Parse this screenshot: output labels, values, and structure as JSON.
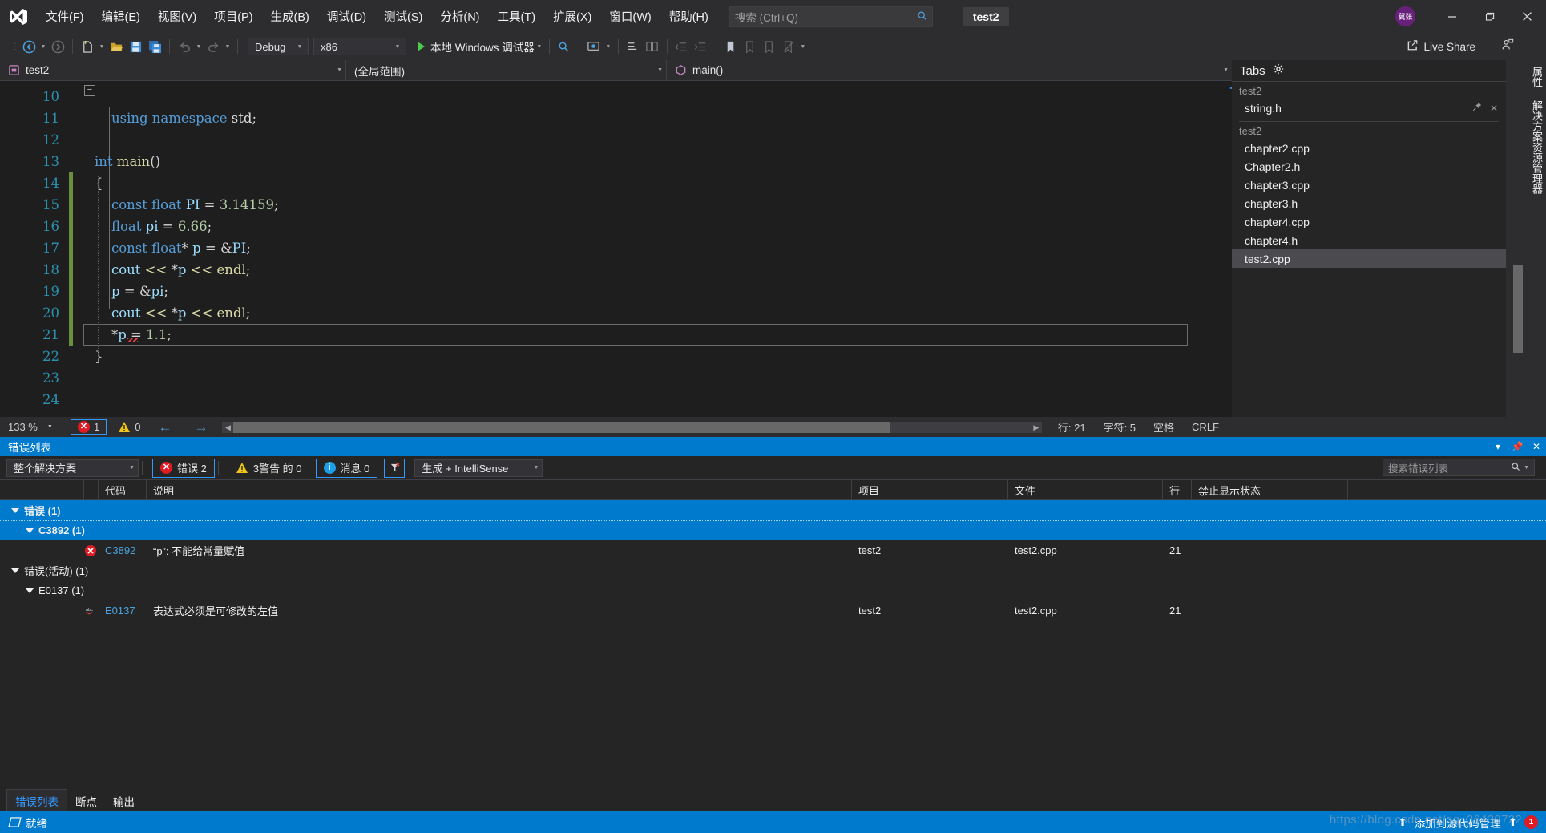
{
  "titlebar": {
    "logo_icon": "visual-studio-logo",
    "menus": [
      "文件(F)",
      "编辑(E)",
      "视图(V)",
      "项目(P)",
      "生成(B)",
      "调试(D)",
      "测试(S)",
      "分析(N)",
      "工具(T)",
      "扩展(X)",
      "窗口(W)",
      "帮助(H)"
    ],
    "search_placeholder": "搜索 (Ctrl+Q)",
    "search_icon": "search-icon",
    "project_chip": "test2",
    "avatar_text": "冀张",
    "minimize_icon": "minimize-icon",
    "restore_icon": "restore-icon",
    "close_icon": "close-icon"
  },
  "toolbar": {
    "nav_back_icon": "navigate-back-icon",
    "nav_forward_icon": "navigate-forward-icon",
    "new_item_icon": "new-item-icon",
    "open_icon": "open-folder-icon",
    "save_icon": "save-icon",
    "save_all_icon": "save-all-icon",
    "undo_icon": "undo-icon",
    "redo_icon": "redo-icon",
    "config": "Debug",
    "platform": "x86",
    "run_label": "本地 Windows 调试器",
    "run_icon": "play-icon",
    "live_share_label": "Live Share",
    "live_share_icon": "live-share-icon",
    "feedback_icon": "feedback-icon"
  },
  "editor_nav": {
    "project": "test2",
    "scope": "(全局范围)",
    "member": "main()",
    "project_icon": "project-icon",
    "member_icon": "method-icon"
  },
  "code": {
    "lines": [
      {
        "num": "10",
        "changed": false,
        "tokens": []
      },
      {
        "num": "11",
        "changed": false,
        "tokens": [
          {
            "t": "    ",
            "c": "op"
          },
          {
            "t": "using",
            "c": "k"
          },
          {
            "t": " ",
            "c": "op"
          },
          {
            "t": "namespace",
            "c": "k"
          },
          {
            "t": " ",
            "c": "op"
          },
          {
            "t": "std",
            "c": "id"
          },
          {
            "t": ";",
            "c": "op"
          }
        ]
      },
      {
        "num": "12",
        "changed": false,
        "tokens": []
      },
      {
        "num": "13",
        "changed": false,
        "tokens": [
          {
            "t": "int",
            "c": "k"
          },
          {
            "t": " ",
            "c": "op"
          },
          {
            "t": "main",
            "c": "fn"
          },
          {
            "t": "()",
            "c": "op"
          }
        ]
      },
      {
        "num": "14",
        "changed": true,
        "tokens": [
          {
            "t": "{",
            "c": "op"
          }
        ]
      },
      {
        "num": "15",
        "changed": true,
        "tokens": [
          {
            "t": "    ",
            "c": "op"
          },
          {
            "t": "const",
            "c": "k"
          },
          {
            "t": " ",
            "c": "op"
          },
          {
            "t": "float",
            "c": "k"
          },
          {
            "t": " ",
            "c": "op"
          },
          {
            "t": "PI",
            "c": "var"
          },
          {
            "t": " = ",
            "c": "op"
          },
          {
            "t": "3.14159",
            "c": "n"
          },
          {
            "t": ";",
            "c": "op"
          }
        ]
      },
      {
        "num": "16",
        "changed": true,
        "tokens": [
          {
            "t": "    ",
            "c": "op"
          },
          {
            "t": "float",
            "c": "k"
          },
          {
            "t": " ",
            "c": "op"
          },
          {
            "t": "pi",
            "c": "var"
          },
          {
            "t": " = ",
            "c": "op"
          },
          {
            "t": "6.66",
            "c": "n"
          },
          {
            "t": ";",
            "c": "op"
          }
        ]
      },
      {
        "num": "17",
        "changed": true,
        "tokens": [
          {
            "t": "    ",
            "c": "op"
          },
          {
            "t": "const",
            "c": "k"
          },
          {
            "t": " ",
            "c": "op"
          },
          {
            "t": "float",
            "c": "k"
          },
          {
            "t": "* ",
            "c": "op"
          },
          {
            "t": "p",
            "c": "var"
          },
          {
            "t": " = ",
            "c": "op"
          },
          {
            "t": "&",
            "c": "op"
          },
          {
            "t": "PI",
            "c": "var"
          },
          {
            "t": ";",
            "c": "op"
          }
        ]
      },
      {
        "num": "18",
        "changed": true,
        "tokens": [
          {
            "t": "    ",
            "c": "op"
          },
          {
            "t": "cout",
            "c": "var"
          },
          {
            "t": " ",
            "c": "op"
          },
          {
            "t": "<<",
            "c": "fn"
          },
          {
            "t": " *",
            "c": "op"
          },
          {
            "t": "p",
            "c": "var"
          },
          {
            "t": " ",
            "c": "op"
          },
          {
            "t": "<<",
            "c": "fn"
          },
          {
            "t": " ",
            "c": "op"
          },
          {
            "t": "endl",
            "c": "fn"
          },
          {
            "t": ";",
            "c": "op"
          }
        ]
      },
      {
        "num": "19",
        "changed": true,
        "tokens": [
          {
            "t": "    ",
            "c": "op"
          },
          {
            "t": "p",
            "c": "var"
          },
          {
            "t": " = ",
            "c": "op"
          },
          {
            "t": "&",
            "c": "op"
          },
          {
            "t": "pi",
            "c": "var"
          },
          {
            "t": ";",
            "c": "op"
          }
        ]
      },
      {
        "num": "20",
        "changed": true,
        "tokens": [
          {
            "t": "    ",
            "c": "op"
          },
          {
            "t": "cout",
            "c": "var"
          },
          {
            "t": " ",
            "c": "op"
          },
          {
            "t": "<<",
            "c": "fn"
          },
          {
            "t": " *",
            "c": "op"
          },
          {
            "t": "p",
            "c": "var"
          },
          {
            "t": " ",
            "c": "op"
          },
          {
            "t": "<<",
            "c": "fn"
          },
          {
            "t": " ",
            "c": "op"
          },
          {
            "t": "endl",
            "c": "fn"
          },
          {
            "t": ";",
            "c": "op"
          }
        ]
      },
      {
        "num": "21",
        "changed": true,
        "current": true,
        "tokens": [
          {
            "t": "    *",
            "c": "op"
          },
          {
            "t": "p",
            "c": "var"
          },
          {
            "t": " = ",
            "c": "op"
          },
          {
            "t": "1.1",
            "c": "n"
          },
          {
            "t": ";",
            "c": "op"
          }
        ]
      },
      {
        "num": "22",
        "changed": false,
        "tokens": [
          {
            "t": "}",
            "c": "op"
          }
        ]
      },
      {
        "num": "23",
        "changed": false,
        "tokens": []
      },
      {
        "num": "24",
        "changed": false,
        "tokens": []
      }
    ]
  },
  "editor_status": {
    "zoom": "133 %",
    "error_count": "1",
    "warning_count": "0",
    "prev_icon": "arrow-left-icon",
    "next_icon": "arrow-right-icon",
    "line_label": "行: 21",
    "col_label": "字符: 5",
    "indent_label": "空格",
    "eol_label": "CRLF"
  },
  "error_panel": {
    "title": "错误列表",
    "float_icon": "float-window-icon",
    "pin_icon": "pin-icon",
    "close_icon": "close-icon",
    "scope": "整个解决方案",
    "errors_label": "错误 2",
    "warnings_label": "3警告 的 0",
    "messages_label": "消息 0",
    "build_filter": "生成 + IntelliSense",
    "filter_icon": "clear-filter-icon",
    "search_placeholder": "搜索错误列表",
    "search_icon": "search-icon",
    "columns": [
      "",
      "代码",
      "说明",
      "项目",
      "文件",
      "行",
      "禁止显示状态"
    ],
    "rows": [
      {
        "kind": "group",
        "level": 1,
        "label": "错误 (1)",
        "selected": true
      },
      {
        "kind": "group",
        "level": 2,
        "label": "C3892 (1)",
        "selected": true
      },
      {
        "kind": "error",
        "level": 3,
        "icon": "error-circle-icon",
        "code": "C3892",
        "desc": "“p”: 不能给常量赋值",
        "project": "test2",
        "file": "test2.cpp",
        "line": "21",
        "suppress": ""
      },
      {
        "kind": "group",
        "level": 1,
        "label": "错误(活动) (1)",
        "selected": false
      },
      {
        "kind": "group",
        "level": 2,
        "label": "E0137 (1)",
        "selected": false
      },
      {
        "kind": "error",
        "level": 3,
        "icon": "intellisense-squiggle-icon",
        "code": "E0137",
        "desc": "表达式必须是可修改的左值",
        "project": "test2",
        "file": "test2.cpp",
        "line": "21",
        "suppress": ""
      }
    ]
  },
  "bottom_tabs": {
    "items": [
      "错误列表",
      "断点",
      "输出"
    ],
    "active_index": 0
  },
  "statusbar": {
    "ready_label": "就绪",
    "ready_icon": "ready-icon",
    "add_source_control": "添加到源代码管理",
    "up_icon": "chevron-up-icon",
    "badge": "1",
    "watermark": "https://blog.csdn.net/qq_36439722"
  },
  "tabs_panel": {
    "title": "Tabs",
    "gear_icon": "gear-icon",
    "groups": [
      {
        "header": "test2",
        "items": [
          {
            "label": "string.h",
            "selected": false,
            "has_actions": true
          }
        ]
      },
      {
        "header": "test2",
        "items": [
          {
            "label": "chapter2.cpp",
            "selected": false
          },
          {
            "label": "Chapter2.h",
            "selected": false
          },
          {
            "label": "chapter3.cpp",
            "selected": false
          },
          {
            "label": "chapter3.h",
            "selected": false
          },
          {
            "label": "chapter4.cpp",
            "selected": false
          },
          {
            "label": "chapter4.h",
            "selected": false
          },
          {
            "label": "test2.cpp",
            "selected": true
          }
        ]
      }
    ],
    "pin_icon": "pin-icon",
    "close_icon": "close-icon"
  },
  "dock_tabs": [
    "属性",
    "解决方案资源管理器"
  ],
  "colors": {
    "accent": "#007acc",
    "editor_bg": "#1e1e1e",
    "chrome_bg": "#2d2d30",
    "panel_bg": "#252526",
    "error_red": "#e01b24",
    "warn_yellow": "#f0c419",
    "link_blue": "#4aa3df",
    "keyword_blue": "#569cd6",
    "number_green": "#b5cea8",
    "change_green": "#6b8f3e"
  }
}
